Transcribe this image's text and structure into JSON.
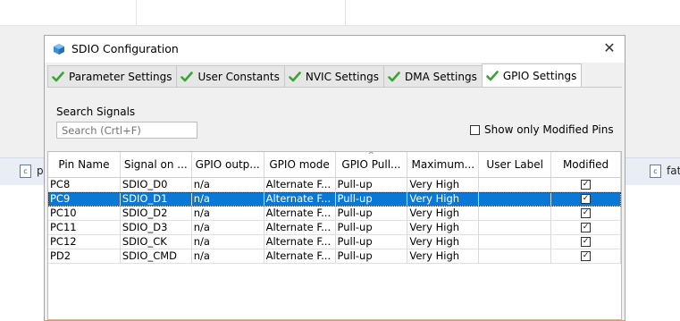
{
  "background": {
    "file_tabs": [
      {
        "label": "pc"
      },
      {
        "label": "fatfs"
      }
    ]
  },
  "dialog": {
    "title": "SDIO Configuration",
    "close_label": "✕",
    "tabs": [
      {
        "label": "Parameter Settings",
        "active": false
      },
      {
        "label": "User Constants",
        "active": false
      },
      {
        "label": "NVIC Settings",
        "active": false
      },
      {
        "label": "DMA Settings",
        "active": false
      },
      {
        "label": "GPIO Settings",
        "active": true
      }
    ],
    "search": {
      "label": "Search Signals",
      "placeholder": "Search (Crtl+F)"
    },
    "show_modified_label": "Show only Modified Pins",
    "table": {
      "columns": [
        "Pin Name",
        "Signal on ...",
        "GPIO outp...",
        "GPIO mode",
        "GPIO Pull...",
        "Maximum...",
        "User Label",
        "Modified"
      ],
      "rows": [
        {
          "pin": "PC8",
          "signal": "SDIO_D0",
          "output": "n/a",
          "mode": "Alternate F...",
          "pull": "Pull-up",
          "max": "Very High",
          "label": "",
          "modified": true,
          "selected": false
        },
        {
          "pin": "PC9",
          "signal": "SDIO_D1",
          "output": "n/a",
          "mode": "Alternate F...",
          "pull": "Pull-up",
          "max": "Very High",
          "label": "",
          "modified": true,
          "selected": true
        },
        {
          "pin": "PC10",
          "signal": "SDIO_D2",
          "output": "n/a",
          "mode": "Alternate F...",
          "pull": "Pull-up",
          "max": "Very High",
          "label": "",
          "modified": true,
          "selected": false
        },
        {
          "pin": "PC11",
          "signal": "SDIO_D3",
          "output": "n/a",
          "mode": "Alternate F...",
          "pull": "Pull-up",
          "max": "Very High",
          "label": "",
          "modified": true,
          "selected": false
        },
        {
          "pin": "PC12",
          "signal": "SDIO_CK",
          "output": "n/a",
          "mode": "Alternate F...",
          "pull": "Pull-up",
          "max": "Very High",
          "label": "",
          "modified": true,
          "selected": false
        },
        {
          "pin": "PD2",
          "signal": "SDIO_CMD",
          "output": "n/a",
          "mode": "Alternate F...",
          "pull": "Pull-up",
          "max": "Very High",
          "label": "",
          "modified": true,
          "selected": false
        }
      ]
    }
  },
  "colors": {
    "selection": "#0a78d7",
    "dialog_border": "#e69068",
    "check_green": "#3aa335"
  }
}
